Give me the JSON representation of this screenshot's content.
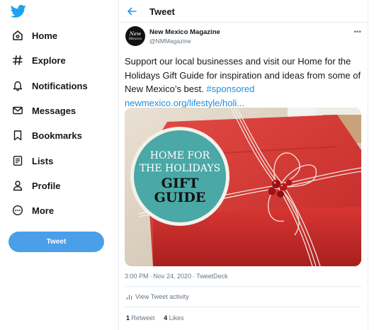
{
  "sidebar": {
    "items": [
      {
        "label": "Home",
        "icon": "home-icon"
      },
      {
        "label": "Explore",
        "icon": "hashtag-icon"
      },
      {
        "label": "Notifications",
        "icon": "bell-icon"
      },
      {
        "label": "Messages",
        "icon": "envelope-icon"
      },
      {
        "label": "Bookmarks",
        "icon": "bookmark-icon"
      },
      {
        "label": "Lists",
        "icon": "list-icon"
      },
      {
        "label": "Profile",
        "icon": "person-icon"
      },
      {
        "label": "More",
        "icon": "more-circle-icon"
      }
    ],
    "tweet_button": "Tweet"
  },
  "header": {
    "title": "Tweet"
  },
  "tweet": {
    "author_name": "New Mexico Magazine",
    "author_handle": "@NMMagazine",
    "avatar_line1": "New",
    "avatar_line2": "Mexico",
    "text": "Support our local businesses and visit our Home for the Holidays Gift Guide for inspiration and ideas from some of New Mexico’s best.",
    "hashtag": "#sponsored",
    "link": "newmexico.org/lifestyle/holi...",
    "time": "3:00 PM",
    "date": "Nov 24, 2020",
    "source": "TweetDeck",
    "activity_label": "View Tweet activity",
    "retweets_count": "1",
    "retweets_label": "Retweet",
    "likes_count": "4",
    "likes_label": "Likes"
  },
  "media": {
    "circle_line1": "HOME FOR",
    "circle_line2": "THE HOLIDAYS",
    "circle_line3": "GIFT",
    "circle_line4": "GUIDE"
  },
  "colors": {
    "accent": "#1d9bf0",
    "tweet_button": "#4a9fe8",
    "gift_red": "#d8322f",
    "circle_teal": "#4aa8a6"
  }
}
